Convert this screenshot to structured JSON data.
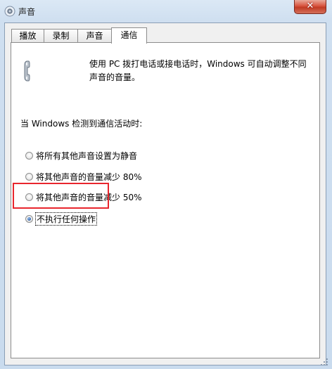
{
  "window": {
    "title": "声音",
    "close_label": "✕",
    "icons": {
      "app": "speaker-icon",
      "close": "close-icon"
    }
  },
  "tabs": [
    {
      "label": "播放",
      "active": false
    },
    {
      "label": "录制",
      "active": false
    },
    {
      "label": "声音",
      "active": false
    },
    {
      "label": "通信",
      "active": true
    }
  ],
  "communications": {
    "icon": "phone-icon",
    "description": "使用 PC 拨打电话或接电话时，Windows 可自动调整不同声音的音量。",
    "section_label": "当 Windows 检测到通信活动时:",
    "options": [
      {
        "label": "将所有其他声音设置为静音",
        "checked": false
      },
      {
        "label": "将其他声音的音量减少 80%",
        "checked": false
      },
      {
        "label": "将其他声音的音量减少 50%",
        "checked": false
      },
      {
        "label": "不执行任何操作",
        "checked": true
      }
    ]
  },
  "colors": {
    "highlight_box": "#e8262d",
    "close_button": "#c13b24",
    "title_bar": "#dbe8f5"
  }
}
